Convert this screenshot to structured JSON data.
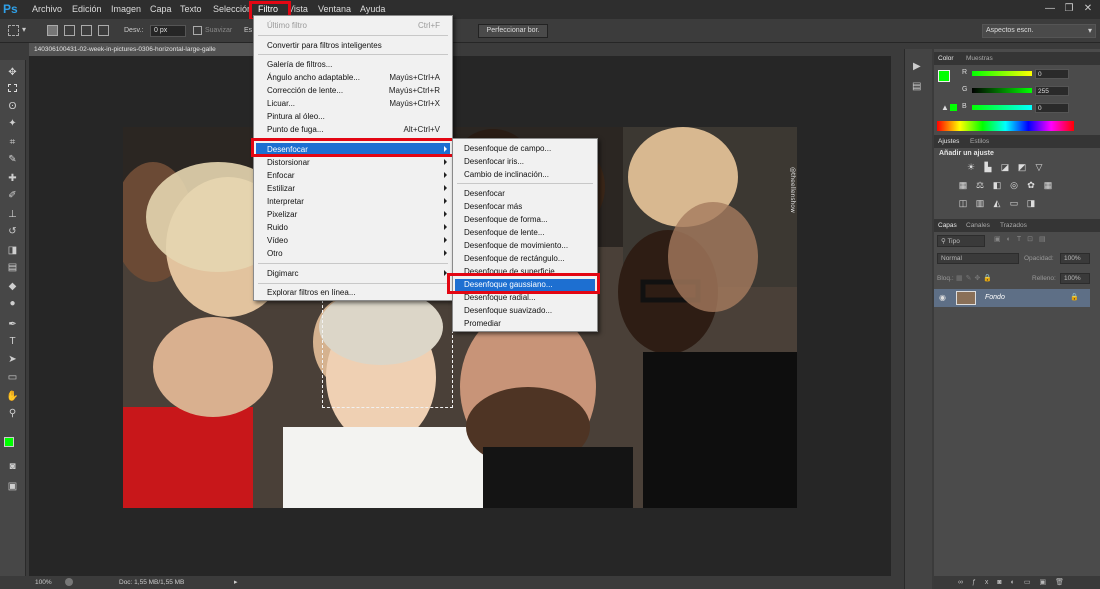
{
  "app": {
    "logo": "Ps"
  },
  "menubar": {
    "items": [
      "Archivo",
      "Edición",
      "Imagen",
      "Capa",
      "Texto",
      "Selección",
      "Filtro",
      "Vista",
      "Ventana",
      "Ayuda"
    ],
    "window_buttons": [
      "—",
      "❐",
      "✕"
    ]
  },
  "options_bar": {
    "feather_label": "Desv.:",
    "feather_value": "0 px",
    "antialias_label": "Suavizar",
    "style_label": "Es",
    "refine_edge": "Perfeccionar bor.",
    "workspace": "Aspectos escn."
  },
  "document": {
    "tab_title": "140306100431-02-week-in-pictures-0306-horizontal-large-galle"
  },
  "status": {
    "zoom": "100%",
    "doc_size": "Doc: 1,55 MB/1,55 MB"
  },
  "filter_menu": {
    "items": [
      {
        "label": "Último filtro",
        "shortcut": "Ctrl+F",
        "disabled": true
      },
      {
        "label": "Convertir para filtros inteligentes"
      },
      {
        "label": "Galería de filtros..."
      },
      {
        "label": "Ángulo ancho adaptable...",
        "shortcut": "Mayús+Ctrl+A"
      },
      {
        "label": "Corrección de lente...",
        "shortcut": "Mayús+Ctrl+R"
      },
      {
        "label": "Licuar...",
        "shortcut": "Mayús+Ctrl+X"
      },
      {
        "label": "Pintura al óleo..."
      },
      {
        "label": "Punto de fuga...",
        "shortcut": "Alt+Ctrl+V"
      },
      {
        "label": "Desenfocar",
        "highlighted": true
      },
      {
        "label": "Distorsionar"
      },
      {
        "label": "Enfocar"
      },
      {
        "label": "Estilizar"
      },
      {
        "label": "Interpretar"
      },
      {
        "label": "Pixelizar"
      },
      {
        "label": "Ruido"
      },
      {
        "label": "Vídeo"
      },
      {
        "label": "Otro"
      },
      {
        "label": "Digimarc"
      },
      {
        "label": "Explorar filtros en línea..."
      }
    ]
  },
  "blur_submenu": {
    "items": [
      "Desenfoque de campo...",
      "Desenfocar iris...",
      "Cambio de inclinación...",
      "Desenfocar",
      "Desenfocar más",
      "Desenfoque de forma...",
      "Desenfoque de lente...",
      "Desenfoque de movimiento...",
      "Desenfoque de rectángulo...",
      "Desenfoque de superficie...",
      "Desenfoque gaussiano...",
      "Desenfoque radial...",
      "Desenfoque suavizado...",
      "Promediar"
    ],
    "highlighted": "Desenfoque gaussiano..."
  },
  "color_panel": {
    "tabs": [
      "Color",
      "Muestras"
    ],
    "channels": [
      {
        "label": "R",
        "value": "0"
      },
      {
        "label": "G",
        "value": "255"
      },
      {
        "label": "B",
        "value": "0"
      }
    ],
    "foreground": "#00ff00"
  },
  "adjustments_panel": {
    "tabs": [
      "Ajustes",
      "Estilos"
    ],
    "heading": "Añadir un ajuste"
  },
  "layers_panel": {
    "tabs": [
      "Capas",
      "Canales",
      "Trazados"
    ],
    "kind_filter": "Tipo",
    "blend_mode": "Normal",
    "opacity_label": "Opacidad:",
    "opacity_value": "100%",
    "lock_label": "Bloq.:",
    "fill_label": "Relleno:",
    "fill_value": "100%",
    "layer_name": "Fondo"
  },
  "colors": {
    "highlight": "#1d6fd1",
    "annotation_red": "#e30613",
    "foreground_green": "#00ff00"
  }
}
